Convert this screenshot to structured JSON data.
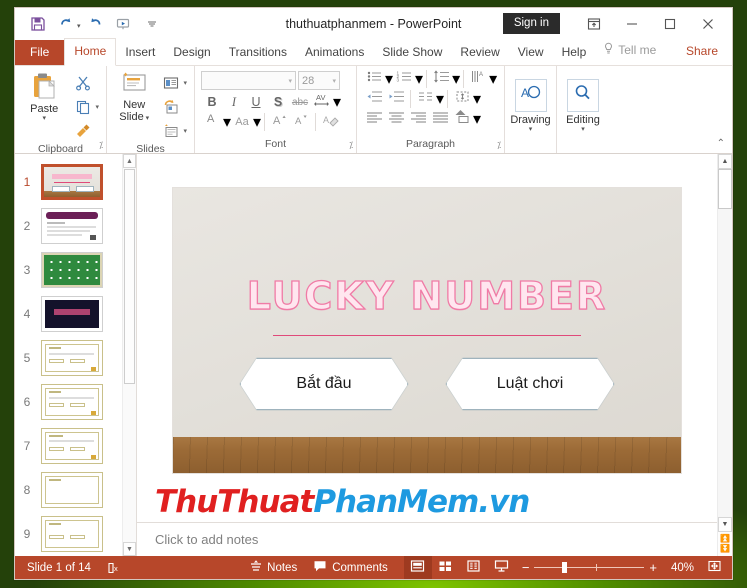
{
  "window": {
    "title": "thuthuatphanmem  -  PowerPoint",
    "signin_label": "Sign in",
    "quick_access": [
      {
        "name": "save-button",
        "icon": "save-icon"
      },
      {
        "name": "undo-button",
        "icon": "undo-icon"
      },
      {
        "name": "redo-button",
        "icon": "redo-icon"
      },
      {
        "name": "start-from-beginning-button",
        "icon": "slideshow-icon"
      },
      {
        "name": "customize-quick-access-toolbar",
        "icon": "chevron-down-icon"
      }
    ],
    "controls": {
      "ribbon_display_options": "ribbon-display-options-icon",
      "minimize": "minimize-icon",
      "restore": "restore-icon",
      "close": "close-icon"
    }
  },
  "tabs": {
    "file": "File",
    "items": [
      {
        "label": "Home",
        "active": true
      },
      {
        "label": "Insert",
        "active": false
      },
      {
        "label": "Design",
        "active": false
      },
      {
        "label": "Transitions",
        "active": false
      },
      {
        "label": "Animations",
        "active": false
      },
      {
        "label": "Slide Show",
        "active": false
      },
      {
        "label": "Review",
        "active": false
      },
      {
        "label": "View",
        "active": false
      },
      {
        "label": "Help",
        "active": false
      }
    ],
    "tell_me": "Tell me",
    "share": "Share"
  },
  "ribbon": {
    "collapse_label": "⌃",
    "groups": {
      "clipboard": {
        "label": "Clipboard",
        "paste_label": "Paste",
        "buttons": [
          "cut-icon",
          "copy-icon",
          "format-painter-icon"
        ]
      },
      "slides": {
        "label": "Slides",
        "new_slide_label": "New\nSlide",
        "new_slide_line1": "New",
        "new_slide_line2": "Slide",
        "buttons": [
          "layout-icon",
          "reset-icon",
          "section-icon"
        ]
      },
      "font": {
        "label": "Font",
        "font_name_value": "",
        "font_name_placeholder": "",
        "font_size_value": "28",
        "buttons": [
          "bold-icon",
          "italic-icon",
          "underline-icon",
          "text-shadow-icon",
          "strikethrough-icon",
          "character-spacing-icon",
          "font-color-icon",
          "change-case-icon",
          "increase-font-size-icon",
          "decrease-font-size-icon",
          "clear-formatting-icon"
        ],
        "bold": "B",
        "italic": "I",
        "underline": "U",
        "shadow": "S",
        "strikethrough": "abc",
        "spacing": "AV",
        "font_color": "A",
        "change_case": "Aa",
        "grow_font": "A",
        "shrink_font": "A"
      },
      "paragraph": {
        "label": "Paragraph",
        "buttons": [
          "bullets-icon",
          "numbering-icon",
          "decrease-indent-icon",
          "increase-indent-icon",
          "line-spacing-icon",
          "text-direction-icon",
          "align-text-icon",
          "convert-to-smartart-icon",
          "align-left-icon",
          "align-center-icon",
          "align-right-icon",
          "justify-icon",
          "columns-icon"
        ]
      },
      "drawing": {
        "label": "Drawing",
        "icon": "drawing-shapes-icon"
      },
      "editing": {
        "label": "Editing",
        "icon": "find-magnifier-icon"
      }
    }
  },
  "thumbnails": [
    {
      "number": "1",
      "selected": true,
      "style": "title"
    },
    {
      "number": "2",
      "selected": false,
      "style": "purple"
    },
    {
      "number": "3",
      "selected": false,
      "style": "green"
    },
    {
      "number": "4",
      "selected": false,
      "style": "dark"
    },
    {
      "number": "5",
      "selected": false,
      "style": "yellow"
    },
    {
      "number": "6",
      "selected": false,
      "style": "yellow"
    },
    {
      "number": "7",
      "selected": false,
      "style": "yellow"
    },
    {
      "number": "8",
      "selected": false,
      "style": "yellow"
    },
    {
      "number": "9",
      "selected": false,
      "style": "yellow"
    }
  ],
  "slide": {
    "title": "LUCKY NUMBER",
    "buttons": [
      {
        "label": "Bắt đầu"
      },
      {
        "label": "Luật chơi"
      }
    ],
    "colors": {
      "title_fill": "#ffe6ef",
      "title_outline": "#f07ba6",
      "rule": "#e04a7a",
      "wall": "#e5e2dc",
      "floor": "#a87742",
      "button_border": "#9fb3bd"
    }
  },
  "notes": {
    "placeholder": "Click to add notes"
  },
  "watermark": {
    "part1": "ThuThuat",
    "part2": "PhanMem.vn",
    "color1": "#e02020",
    "color2": "#1e9ae0"
  },
  "statusbar": {
    "slide_counter": "Slide 1 of 14",
    "language_icon": "accessibility-icon",
    "notes_label": "Notes",
    "comments_label": "Comments",
    "views": [
      {
        "name": "normal-view-button",
        "icon": "normal-view-icon",
        "active": true
      },
      {
        "name": "slide-sorter-view-button",
        "icon": "slide-sorter-icon",
        "active": false
      },
      {
        "name": "reading-view-button",
        "icon": "reading-view-icon",
        "active": false
      },
      {
        "name": "slide-show-button",
        "icon": "slide-show-icon",
        "active": false
      }
    ],
    "zoom_out": "−",
    "zoom_in": "+",
    "zoom_level": "40%",
    "fit_to_window": "fit-slide-icon",
    "accent_color": "#b7472a"
  }
}
